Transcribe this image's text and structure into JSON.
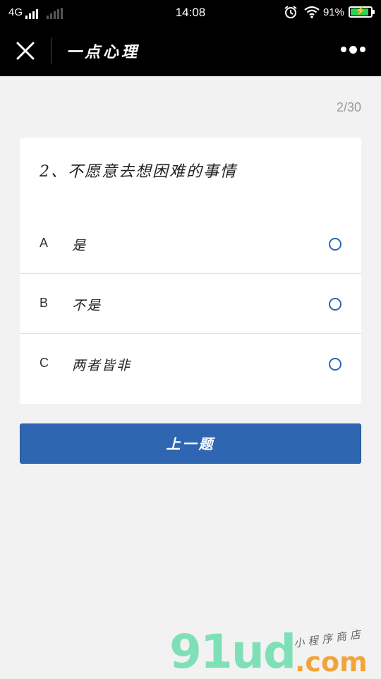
{
  "status_bar": {
    "network": "4G",
    "time": "14:08",
    "battery_percent": "91%",
    "battery_level": 0.91,
    "icons": [
      "signal-icon",
      "alarm-icon",
      "wifi-icon",
      "battery-icon"
    ]
  },
  "nav": {
    "title": "一点心理",
    "close_icon": "close-icon",
    "more_icon": "more-icon"
  },
  "progress": "2/30",
  "question": {
    "text": "2、不愿意去想困难的事情",
    "options": [
      {
        "letter": "A",
        "text": "是"
      },
      {
        "letter": "B",
        "text": "不是"
      },
      {
        "letter": "C",
        "text": "两者皆非"
      }
    ]
  },
  "prev_button": "上一题",
  "watermark": {
    "main": "91ud",
    "suffix": ".com",
    "tagline": "小程序商店",
    "colors": {
      "main": "#7fe0b8",
      "suffix": "#f2a43a"
    }
  },
  "colors": {
    "accent": "#2e66b2",
    "background": "#f2f2f2",
    "nav_background": "#000000"
  }
}
